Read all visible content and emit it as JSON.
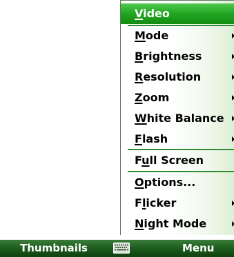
{
  "menu": {
    "items": [
      {
        "pre": "",
        "ul": "V",
        "post": "ideo",
        "selected": true,
        "submenu": false
      },
      {
        "pre": "",
        "ul": "M",
        "post": "ode",
        "selected": false,
        "submenu": true
      },
      {
        "pre": "",
        "ul": "B",
        "post": "rightness",
        "selected": false,
        "submenu": true
      },
      {
        "pre": "",
        "ul": "R",
        "post": "esolution",
        "selected": false,
        "submenu": true
      },
      {
        "pre": "",
        "ul": "Z",
        "post": "oom",
        "selected": false,
        "submenu": true
      },
      {
        "pre": "",
        "ul": "W",
        "post": "hite Balance",
        "selected": false,
        "submenu": true
      },
      {
        "pre": "",
        "ul": "F",
        "post": "lash",
        "selected": false,
        "submenu": true
      },
      {
        "pre": "F",
        "ul": "u",
        "post": "ll Screen",
        "selected": false,
        "submenu": false
      },
      {
        "pre": "",
        "ul": "O",
        "post": "ptions...",
        "selected": false,
        "submenu": false
      },
      {
        "pre": "F",
        "ul": "l",
        "post": "icker",
        "selected": false,
        "submenu": true
      },
      {
        "pre": "",
        "ul": "N",
        "post": "ight Mode",
        "selected": false,
        "submenu": true
      }
    ]
  },
  "softkeys": {
    "left": "Thumbnails",
    "right": "Menu",
    "center_icon": "keyboard-icon"
  },
  "colors": {
    "selection": "#21a521",
    "separator": "#2e8b2e",
    "softbar": "#1f5e1f"
  }
}
